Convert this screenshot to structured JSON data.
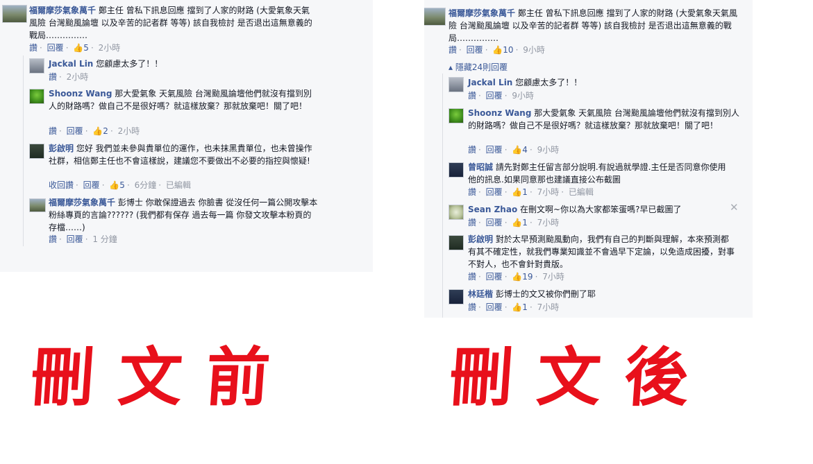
{
  "left": {
    "post": {
      "author": "福爾摩莎氣象萬千",
      "text": "鄭主任 曾私下訊息回應 擋到了人家的財路 (大愛氣象天氣風險 台灣颱風論壇 以及辛苦的記者群 等等) 該自我檢討 是否退出這無意義的戰局……………",
      "actions": [
        "讚",
        "回覆"
      ],
      "likes": "5",
      "time": "2小時"
    },
    "comments": [
      {
        "author": "Jackal Lin",
        "text": "您顧慮太多了！！",
        "actions": [
          "讚"
        ],
        "likes": "",
        "time": "2小時"
      },
      {
        "author": "Shoonz Wang",
        "text": "那大愛氣象 天氣風險 台灣颱風論壇他們就沒有擋到別人的財路嗎？做自己不是很好嗎？就這樣放棄？那就放棄吧！關了吧！",
        "actions": [
          "讚",
          "回覆"
        ],
        "likes": "2",
        "time": "2小時"
      },
      {
        "author": "彭啟明",
        "text": "您好 我們並未參與貴單位的運作，也未抹黑貴單位，也未曾操作社群，相信鄭主任也不會這樣說，建議您不要做出不必要的指控與懷疑!",
        "actions": [
          "收回讚",
          "回覆"
        ],
        "likes": "5",
        "time": "6分鐘",
        "edited": "已編輯"
      },
      {
        "author": "福爾摩莎氣象萬千",
        "text": "彭博士 你敢保證過去 你臉書 從沒任何一篇公開攻擊本粉絲專頁的言論?????? (我們都有保存 過去每一篇 你發文攻擊本粉頁的存檔……)",
        "actions": [
          "讚",
          "回覆"
        ],
        "likes": "",
        "time": "1 分鐘"
      }
    ],
    "caption": "刪文前"
  },
  "right": {
    "post": {
      "author": "福爾摩莎氣象萬千",
      "text": "鄭主任 曾私下訊息回應 擋到了人家的財路 (大愛氣象天氣風險 台灣颱風論壇 以及辛苦的記者群 等等) 該自我檢討 是否退出這無意義的戰局……………",
      "actions": [
        "讚",
        "回覆"
      ],
      "likes": "10",
      "time": "9小時"
    },
    "hidden_replies": "隱藏24則回覆",
    "comments": [
      {
        "author": "Jackal Lin",
        "text": "您顧慮太多了！！",
        "actions": [
          "讚",
          "回覆"
        ],
        "likes": "",
        "time": "9小時"
      },
      {
        "author": "Shoonz Wang",
        "text": "那大愛氣象 天氣風險 台灣颱風論壇他們就沒有擋到別人的財路嗎？做自己不是很好嗎？就這樣放棄？那就放棄吧！關了吧！",
        "actions": [
          "讚",
          "回覆"
        ],
        "likes": "4",
        "time": "9小時"
      },
      {
        "author": "曾昭誠",
        "text": "請先對鄭主任留言部分說明.有說過就學證.主任是否同意你使用他的訊息.如果同意那也建議直接公布截圖",
        "actions": [
          "讚",
          "回覆"
        ],
        "likes": "1",
        "time": "7小時",
        "edited": "已編輯"
      },
      {
        "author": "Sean Zhao",
        "text": "在刪文啊~你以為大家都笨蛋嗎?早已截圖了",
        "actions": [
          "讚",
          "回覆"
        ],
        "likes": "1",
        "time": "7小時",
        "close": "✕"
      },
      {
        "author": "彭啟明",
        "text": "對於太早預測颱風動向，我們有自己的判斷與理解，本來預測都有其不確定性，就我們專業知識並不會過早下定論，以免造成困擾，對事不對人，也不會針對貴版。",
        "actions": [
          "讚",
          "回覆"
        ],
        "likes": "19",
        "time": "7小時"
      },
      {
        "author": "林廷楷",
        "text": "彭博士的文又被你們刪了耶",
        "actions": [
          "讚",
          "回覆"
        ],
        "likes": "1",
        "time": "7小時"
      }
    ],
    "caption": "刪文後"
  },
  "icons": {
    "like": "thumbs-up-icon",
    "hide": "caret-up-icon",
    "close": "close-icon"
  },
  "colors": {
    "link": "#3b5998",
    "meta": "#9197a3",
    "panel": "#f6f7f9",
    "caption": "#e8101b"
  }
}
